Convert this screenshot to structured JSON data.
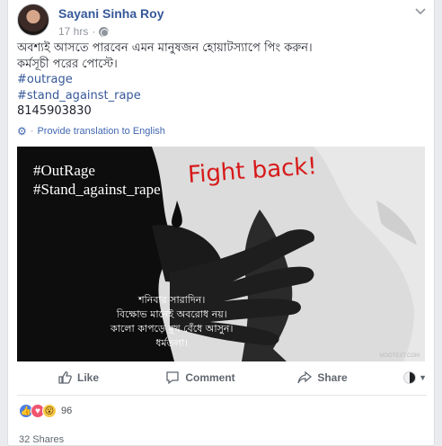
{
  "post": {
    "author": "Sayani Sinha Roy",
    "time": "17 hrs",
    "separator": "·",
    "menu_icon": "chevron-down-icon",
    "body_lines": [
      "অবশ্যই আসতে পারবেন এমন মানুষজন হোয়াটস্যাপে পিং করুন।",
      "কর্মসূচী পরের পোস্টে।"
    ],
    "hashtags": [
      "#outrage",
      "#stand_against_rape"
    ],
    "phone": "8145903830",
    "translate_label": "Provide translation to English"
  },
  "image": {
    "hashtag_lines": [
      "#OutRage",
      "#Stand_against_rape"
    ],
    "headline": "Fight back!",
    "bengali_lines": [
      "শনিবার সারাদিন।",
      "বিক্ষোভ মানেই অবরোধ নয়।",
      "কালো কাপড়ে মুখ বেঁধে আসুন।",
      "ধর্মতলা।"
    ],
    "watermark": "MOOTEXT.COM"
  },
  "actions": {
    "like": "Like",
    "comment": "Comment",
    "share": "Share"
  },
  "stats": {
    "reaction_count": "96",
    "shares": "32 Shares"
  },
  "colors": {
    "link": "#365899",
    "brand_blue": "#4267b2",
    "headline_red": "#d71a1a"
  }
}
